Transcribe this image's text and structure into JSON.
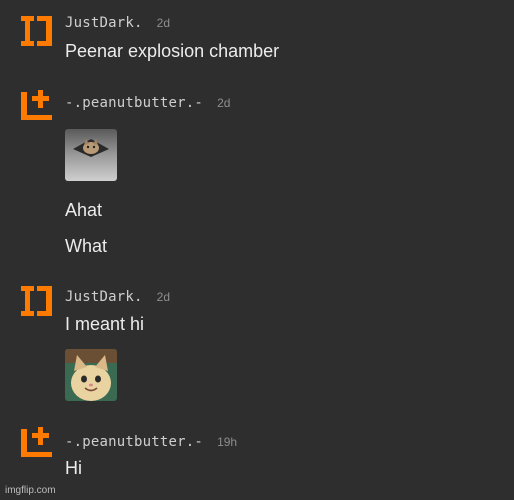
{
  "colors": {
    "background": "#2e2e2f",
    "accent": "#ff7a00",
    "text": "#ececec",
    "muted": "#8e8e8e"
  },
  "messages": [
    {
      "username": "JustDark.",
      "time": "2d",
      "avatar_icon": "orange-block-D-avatar",
      "lines": [
        "Peenar explosion chamber"
      ]
    },
    {
      "username": "-.peanutbutter.-",
      "time": "2d",
      "avatar_icon": "orange-block-L-plus-avatar",
      "image": "ceiling-cat-meme-thumbnail",
      "lines": [
        "Ahat",
        "What"
      ]
    },
    {
      "username": "JustDark.",
      "time": "2d",
      "avatar_icon": "orange-block-D-avatar",
      "lines": [
        "I meant hi"
      ],
      "image": "smiling-cat-meme-thumbnail"
    },
    {
      "username": "-.peanutbutter.-",
      "time": "19h",
      "avatar_icon": "orange-block-L-plus-avatar",
      "lines": [
        "Hi"
      ]
    }
  ],
  "watermark": "imgflip.com"
}
